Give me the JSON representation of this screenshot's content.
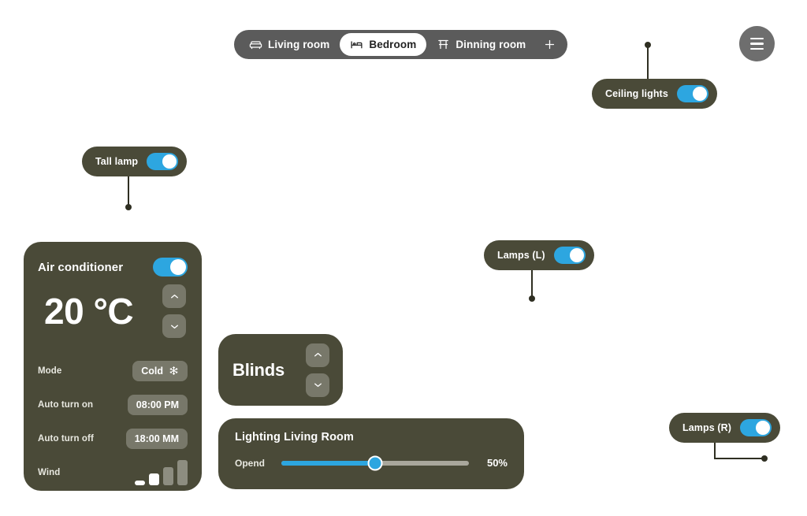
{
  "nav": {
    "tabs": [
      {
        "label": "Living room",
        "icon": "sofa-icon",
        "active": false
      },
      {
        "label": "Bedroom",
        "icon": "bed-icon",
        "active": true
      },
      {
        "label": "Dinning room",
        "icon": "dining-table-icon",
        "active": false
      }
    ],
    "add_label": "+",
    "menu_icon": "hamburger-menu-icon"
  },
  "device_pills": [
    {
      "name": "ceiling-lights",
      "label": "Ceiling lights",
      "state": "on"
    },
    {
      "name": "tall-lamp",
      "label": "Tall lamp",
      "state": "on"
    },
    {
      "name": "lamps-left",
      "label": "Lamps (L)",
      "state": "on"
    },
    {
      "name": "lamps-right",
      "label": "Lamps (R)",
      "state": "on"
    }
  ],
  "air_conditioner": {
    "title": "Air conditioner",
    "power_state": "on",
    "temperature": "20 °C",
    "increase_icon": "chevron-up-icon",
    "decrease_icon": "chevron-down-icon",
    "rows": {
      "mode_label": "Mode",
      "mode_value": "Cold",
      "mode_icon": "snowflake-icon",
      "auto_on_label": "Auto turn on",
      "auto_on_value": "08:00  PM",
      "auto_off_label": "Auto turn off",
      "auto_off_value": "18:00  MM",
      "wind_label": "Wind",
      "wind_icon": "signal-bars-icon",
      "wind_level": 2,
      "wind_levels_total": 4
    }
  },
  "blinds": {
    "title": "Blinds",
    "up_icon": "chevron-up-icon",
    "down_icon": "chevron-down-icon"
  },
  "lighting": {
    "title": "Lighting Living Room",
    "slider_label": "Opend",
    "value_text": "50%",
    "value": 50,
    "min": 0,
    "max": 100
  },
  "colors": {
    "card_bg": "#4a4a38",
    "nav_bg": "#5b5b5b",
    "accent_blue": "#2da6e0",
    "chip_bg": "#78786a",
    "leader_line": "#2f2f22",
    "page_bg": "#ffffff"
  }
}
